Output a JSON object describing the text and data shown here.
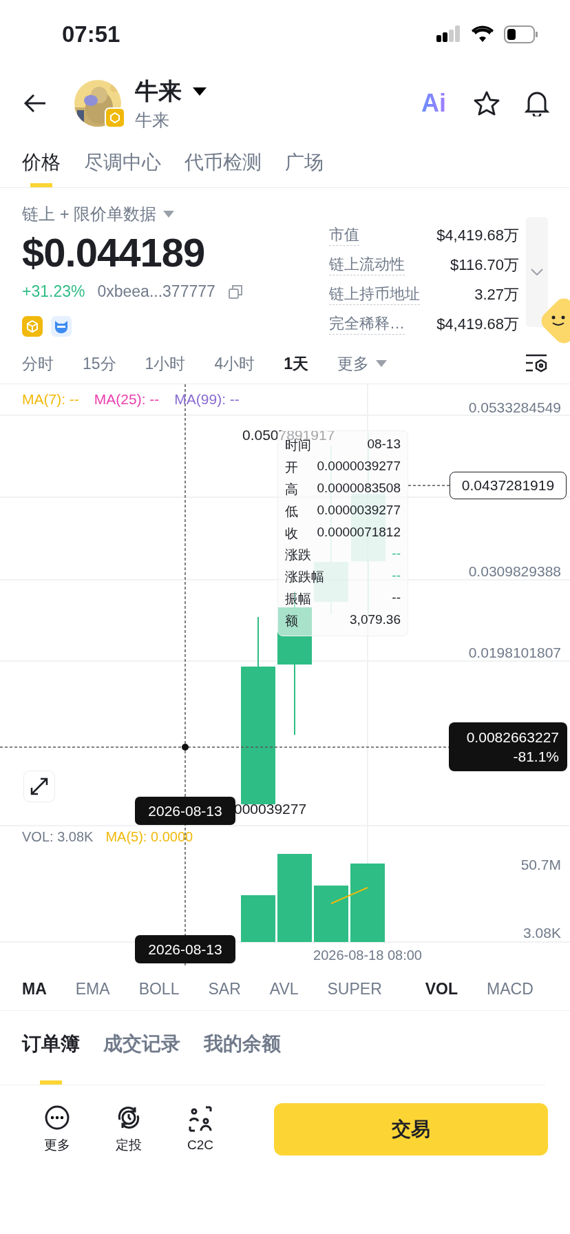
{
  "status_bar": {
    "time": "07:51"
  },
  "header": {
    "title": "牛来",
    "subtitle": "牛来",
    "ai_label": "Ai"
  },
  "tabs": [
    {
      "label": "价格",
      "selected": true
    },
    {
      "label": "尽调中心",
      "selected": false
    },
    {
      "label": "代币检测",
      "selected": false
    },
    {
      "label": "广场",
      "selected": false
    }
  ],
  "data_source": "链上 + 限价单数据",
  "price": "$0.044189",
  "change": "+31.23%",
  "address": "0xbeea...377777",
  "stats": [
    {
      "label": "市值",
      "value": "$4,419.68万"
    },
    {
      "label": "链上流动性",
      "value": "$116.70万"
    },
    {
      "label": "链上持币地址",
      "value": "3.27万"
    },
    {
      "label": "完全稀释…",
      "value": "$4,419.68万"
    }
  ],
  "intervals": [
    {
      "label": "分时",
      "selected": false
    },
    {
      "label": "15分",
      "selected": false
    },
    {
      "label": "1小时",
      "selected": false
    },
    {
      "label": "4小时",
      "selected": false
    },
    {
      "label": "1天",
      "selected": true
    },
    {
      "label": "更多",
      "selected": false,
      "kind": "dropdown"
    }
  ],
  "chart": {
    "ma_legend": [
      {
        "label": "MA(7): --",
        "color": "#f0b90b"
      },
      {
        "label": "MA(25): --",
        "color": "#e93fae"
      },
      {
        "label": "MA(99): --",
        "color": "#8a6bd1"
      }
    ],
    "price_labels": [
      "0.0533284549",
      "0.0309829388",
      "0.0198101807"
    ],
    "high_label": "0.0507891917",
    "low_label": "000039277",
    "marker_price": "0.0437281919",
    "crosshair": {
      "price": "0.0082663227",
      "change": "-81.1%",
      "date": "2026-08-13"
    },
    "tooltip": [
      {
        "label": "时间",
        "value": "08-13",
        "color": "#1e2026"
      },
      {
        "label": "开",
        "value": "0.0000039277",
        "color": "#1e2026"
      },
      {
        "label": "高",
        "value": "0.0000083508",
        "color": "#1e2026"
      },
      {
        "label": "低",
        "value": "0.0000039277",
        "color": "#1e2026"
      },
      {
        "label": "收",
        "value": "0.0000071812",
        "color": "#1e2026"
      },
      {
        "label": "涨跌",
        "value": "--",
        "color": "#2ebd85"
      },
      {
        "label": "涨跌幅",
        "value": "--",
        "color": "#2ebd85"
      },
      {
        "label": "振幅",
        "value": "--",
        "color": "#1e2026"
      },
      {
        "label": "额",
        "value": "3,079.36",
        "color": "#1e2026"
      }
    ]
  },
  "volume": {
    "label": "VOL: 3.08K",
    "ma": "MA(5): 0.0000",
    "axis": [
      "50.7M",
      "3.08K"
    ],
    "date_label": "2026-08-13",
    "x_label": "2026-08-18 08:00"
  },
  "main_indicators": [
    {
      "label": "MA",
      "selected": true
    },
    {
      "label": "EMA",
      "selected": false
    },
    {
      "label": "BOLL",
      "selected": false
    },
    {
      "label": "SAR",
      "selected": false
    },
    {
      "label": "AVL",
      "selected": false
    },
    {
      "label": "SUPER",
      "selected": false
    }
  ],
  "sub_indicators": [
    {
      "label": "VOL",
      "selected": true
    },
    {
      "label": "MACD",
      "selected": false
    }
  ],
  "bottom_tabs": [
    {
      "label": "订单簿",
      "selected": true
    },
    {
      "label": "成交记录",
      "selected": false
    },
    {
      "label": "我的余额",
      "selected": false
    }
  ],
  "actions": [
    {
      "label": "更多",
      "kind": "more"
    },
    {
      "label": "定投",
      "kind": "recurring"
    },
    {
      "label": "C2C",
      "kind": "c2c"
    }
  ],
  "trade_button": "交易"
}
